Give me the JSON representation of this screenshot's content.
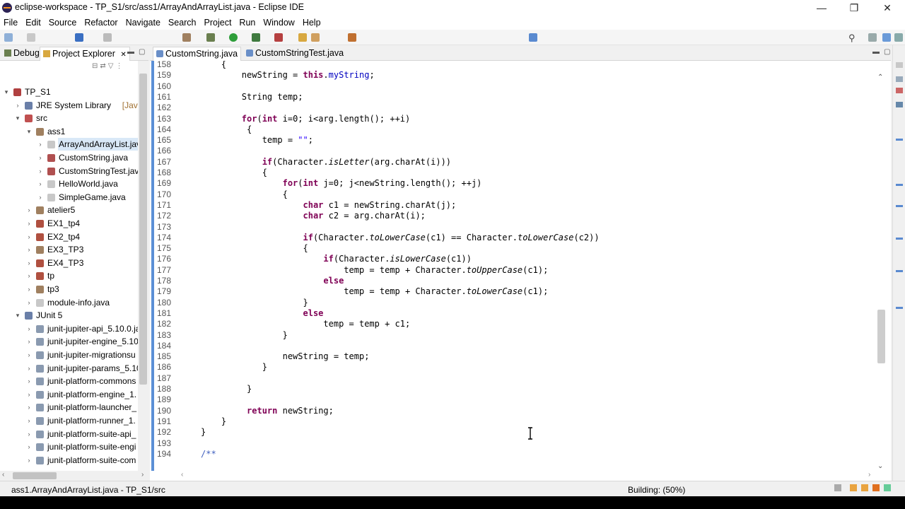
{
  "window": {
    "title": "eclipse-workspace - TP_S1/src/ass1/ArrayAndArrayList.java - Eclipse IDE",
    "minimize": "—",
    "restore": "❐",
    "close": "✕"
  },
  "menu": [
    "File",
    "Edit",
    "Source",
    "Refactor",
    "Navigate",
    "Search",
    "Project",
    "Run",
    "Window",
    "Help"
  ],
  "left_panel": {
    "tabs": [
      "Debug",
      "Project Explorer"
    ],
    "tab_close": "✕",
    "tree": [
      {
        "label": "TP_S1",
        "level": 0,
        "twist": "▾",
        "icon": "project-icon"
      },
      {
        "label": "JRE System Library",
        "suffix": "[JavaSE-",
        "level": 1,
        "twist": "›",
        "icon": "library-icon"
      },
      {
        "label": "src",
        "level": 1,
        "twist": "▾",
        "icon": "source-folder-icon"
      },
      {
        "label": "ass1",
        "level": 2,
        "twist": "▾",
        "icon": "package-icon"
      },
      {
        "label": "ArrayAndArrayList.jav",
        "level": 3,
        "twist": "›",
        "icon": "java-file-icon",
        "selected": true
      },
      {
        "label": "CustomString.java",
        "level": 3,
        "twist": "›",
        "icon": "java-file-error-icon"
      },
      {
        "label": "CustomStringTest.java",
        "level": 3,
        "twist": "›",
        "icon": "java-file-error-icon"
      },
      {
        "label": "HelloWorld.java",
        "level": 3,
        "twist": "›",
        "icon": "java-file-icon"
      },
      {
        "label": "SimpleGame.java",
        "level": 3,
        "twist": "›",
        "icon": "java-file-icon"
      },
      {
        "label": "atelier5",
        "level": 2,
        "twist": "›",
        "icon": "package-icon"
      },
      {
        "label": "EX1_tp4",
        "level": 2,
        "twist": "›",
        "icon": "package-error-icon"
      },
      {
        "label": "EX2_tp4",
        "level": 2,
        "twist": "›",
        "icon": "package-error-icon"
      },
      {
        "label": "EX3_TP3",
        "level": 2,
        "twist": "›",
        "icon": "package-icon"
      },
      {
        "label": "EX4_TP3",
        "level": 2,
        "twist": "›",
        "icon": "package-error-icon"
      },
      {
        "label": "tp",
        "level": 2,
        "twist": "›",
        "icon": "package-error-icon"
      },
      {
        "label": "tp3",
        "level": 2,
        "twist": "›",
        "icon": "package-icon"
      },
      {
        "label": "module-info.java",
        "level": 2,
        "twist": "›",
        "icon": "java-file-icon"
      },
      {
        "label": "JUnit 5",
        "level": 1,
        "twist": "▾",
        "icon": "library-icon"
      },
      {
        "label": "junit-jupiter-api_5.10.0.ja",
        "level": 2,
        "twist": "›",
        "icon": "jar-icon"
      },
      {
        "label": "junit-jupiter-engine_5.10",
        "level": 2,
        "twist": "›",
        "icon": "jar-icon"
      },
      {
        "label": "junit-jupiter-migrationsu",
        "level": 2,
        "twist": "›",
        "icon": "jar-icon"
      },
      {
        "label": "junit-jupiter-params_5.10",
        "level": 2,
        "twist": "›",
        "icon": "jar-icon"
      },
      {
        "label": "junit-platform-commons",
        "level": 2,
        "twist": "›",
        "icon": "jar-icon"
      },
      {
        "label": "junit-platform-engine_1.",
        "level": 2,
        "twist": "›",
        "icon": "jar-icon"
      },
      {
        "label": "junit-platform-launcher_",
        "level": 2,
        "twist": "›",
        "icon": "jar-icon"
      },
      {
        "label": "junit-platform-runner_1.",
        "level": 2,
        "twist": "›",
        "icon": "jar-icon"
      },
      {
        "label": "junit-platform-suite-api_",
        "level": 2,
        "twist": "›",
        "icon": "jar-icon"
      },
      {
        "label": "junit-platform-suite-engi",
        "level": 2,
        "twist": "›",
        "icon": "jar-icon"
      },
      {
        "label": "junit-platform-suite-com",
        "level": 2,
        "twist": "›",
        "icon": "jar-icon"
      }
    ]
  },
  "editor": {
    "tabs": [
      "CustomString.java",
      "CustomStringTest.java"
    ],
    "lines": [
      {
        "n": "158",
        "code": "    {"
      },
      {
        "n": "159",
        "code": "        newString = this.myString;"
      },
      {
        "n": "160",
        "code": ""
      },
      {
        "n": "161",
        "code": "        String temp;"
      },
      {
        "n": "162",
        "code": ""
      },
      {
        "n": "163",
        "code": "        for(int i=0; i<arg.length(); ++i)"
      },
      {
        "n": "164",
        "code": "         {"
      },
      {
        "n": "165",
        "code": "            temp = \"\";"
      },
      {
        "n": "166",
        "code": ""
      },
      {
        "n": "167",
        "code": "            if(Character.isLetter(arg.charAt(i)))"
      },
      {
        "n": "168",
        "code": "            {"
      },
      {
        "n": "169",
        "code": "                for(int j=0; j<newString.length(); ++j)"
      },
      {
        "n": "170",
        "code": "                {"
      },
      {
        "n": "171",
        "code": "                    char c1 = newString.charAt(j);"
      },
      {
        "n": "172",
        "code": "                    char c2 = arg.charAt(i);"
      },
      {
        "n": "173",
        "code": ""
      },
      {
        "n": "174",
        "code": "                    if(Character.toLowerCase(c1) == Character.toLowerCase(c2))"
      },
      {
        "n": "175",
        "code": "                    {"
      },
      {
        "n": "176",
        "code": "                        if(Character.isLowerCase(c1))"
      },
      {
        "n": "177",
        "code": "                            temp = temp + Character.toUpperCase(c1);"
      },
      {
        "n": "178",
        "code": "                        else"
      },
      {
        "n": "179",
        "code": "                            temp = temp + Character.toLowerCase(c1);"
      },
      {
        "n": "180",
        "code": "                    }"
      },
      {
        "n": "181",
        "code": "                    else"
      },
      {
        "n": "182",
        "code": "                        temp = temp + c1;"
      },
      {
        "n": "183",
        "code": "                }"
      },
      {
        "n": "184",
        "code": ""
      },
      {
        "n": "185",
        "code": "                newString = temp;"
      },
      {
        "n": "186",
        "code": "            }"
      },
      {
        "n": "187",
        "code": ""
      },
      {
        "n": "188",
        "code": "         }"
      },
      {
        "n": "189",
        "code": ""
      },
      {
        "n": "190",
        "code": "         return newString;"
      },
      {
        "n": "191",
        "code": "    }"
      },
      {
        "n": "192",
        "code": "}"
      },
      {
        "n": "193",
        "code": ""
      },
      {
        "n": "194",
        "code": "/**",
        "comment": true
      }
    ]
  },
  "status": {
    "path": "ass1.ArrayAndArrayList.java - TP_S1/src",
    "build": "Building: (50%)"
  },
  "colors": {
    "keyword": "#7f0055",
    "field": "#0000c0",
    "string": "#2a00ff",
    "comment": "#3f5fbf",
    "selection": "#d9e8f7",
    "gutter": "#5b8fd6"
  }
}
